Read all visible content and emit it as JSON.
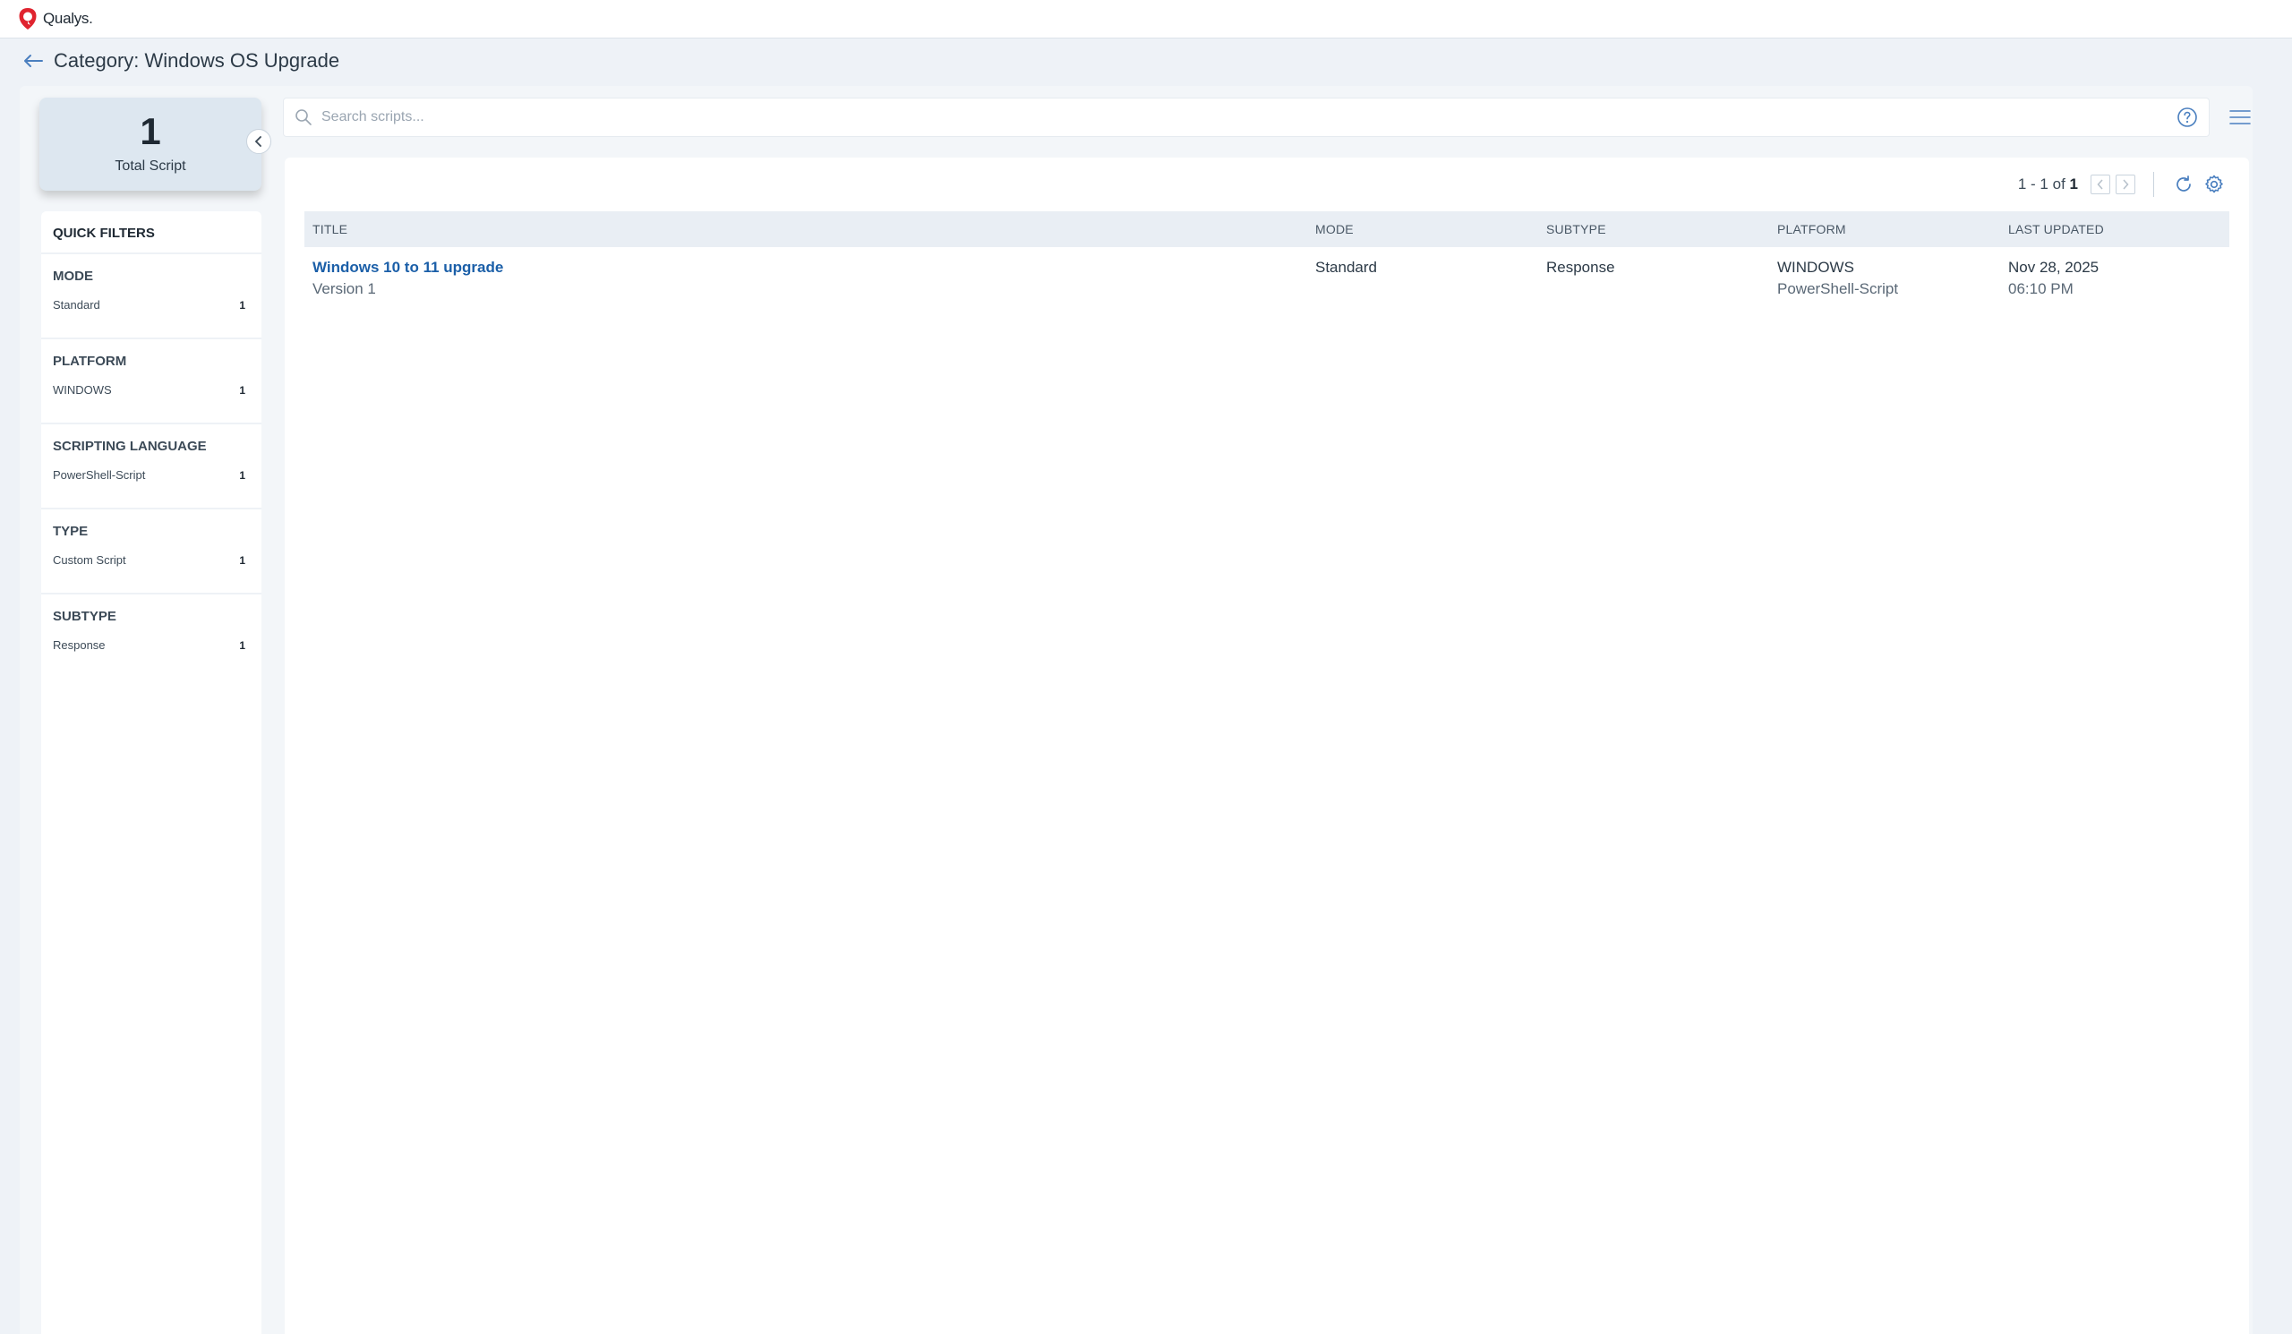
{
  "brand": {
    "name": "Qualys.",
    "accent": "#e0242f"
  },
  "header": {
    "title": "Category: Windows OS Upgrade",
    "back_icon": "arrow-left-icon"
  },
  "summary": {
    "count": "1",
    "label": "Total Script"
  },
  "quick_filters": {
    "title": "QUICK FILTERS",
    "groups": [
      {
        "heading": "MODE",
        "items": [
          {
            "label": "Standard",
            "count": "1"
          }
        ]
      },
      {
        "heading": "PLATFORM",
        "items": [
          {
            "label": "WINDOWS",
            "count": "1"
          }
        ]
      },
      {
        "heading": "SCRIPTING LANGUAGE",
        "items": [
          {
            "label": "PowerShell-Script",
            "count": "1"
          }
        ]
      },
      {
        "heading": "TYPE",
        "items": [
          {
            "label": "Custom Script",
            "count": "1"
          }
        ]
      },
      {
        "heading": "SUBTYPE",
        "items": [
          {
            "label": "Response",
            "count": "1"
          }
        ]
      }
    ]
  },
  "search": {
    "placeholder": "Search scripts..."
  },
  "pagination": {
    "range": "1 - 1 of",
    "total": "1"
  },
  "table": {
    "columns": [
      "TITLE",
      "MODE",
      "SUBTYPE",
      "PLATFORM",
      "LAST UPDATED"
    ],
    "rows": [
      {
        "title": "Windows 10 to 11 upgrade",
        "version": "Version 1",
        "mode": "Standard",
        "subtype": "Response",
        "platform": "WINDOWS",
        "language": "PowerShell-Script",
        "date": "Nov 28, 2025",
        "time": "06:10 PM"
      }
    ]
  },
  "colors": {
    "link": "#1b5fa8",
    "icon": "#4a7fbf",
    "page_bg": "#eef2f7"
  }
}
